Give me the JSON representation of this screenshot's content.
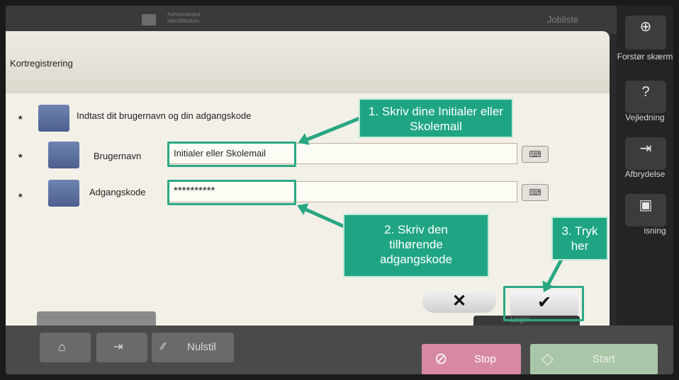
{
  "topbar": {
    "admin_line1": "Administrator",
    "admin_line2": "identifikation",
    "jobliste": "Jobliste"
  },
  "dialog": {
    "title": "Kortregistrering",
    "instruction": "Indtast dit brugernavn og din adgangskode",
    "username_label": "Brugernavn",
    "username_value": "Initialer eller Skolemail",
    "password_label": "Adgangskode",
    "password_value": "**********",
    "asterisk": "*",
    "cancel_glyph": "✕",
    "ok_glyph": "✔"
  },
  "side": {
    "zoom_label": "Forstør skærm",
    "guide_label": "Vejledning",
    "interrupt_label": "Afbrydelse",
    "preview_label": "isning"
  },
  "callouts": {
    "c1": "1. Skriv dine Initialer eller Skolemail",
    "c2": "2. Skriv den tilhørende adgangskode",
    "c3": "3. Tryk her"
  },
  "bottom": {
    "reset_label": "Nulstil",
    "stop_label": "Stop",
    "start_label": "Start",
    "login_label": "Login"
  },
  "colors": {
    "accent": "#1fa583",
    "stop": "#d788a5",
    "start": "#a9c6a9"
  }
}
